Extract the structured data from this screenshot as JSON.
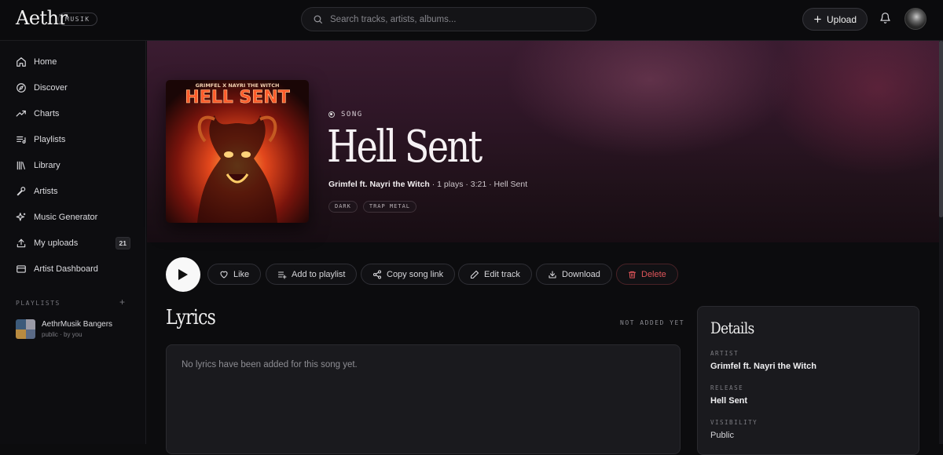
{
  "app": {
    "logo": "Aethr",
    "badge": "MUSIK"
  },
  "search": {
    "placeholder": "Search tracks, artists, albums..."
  },
  "header": {
    "upload_label": "Upload"
  },
  "sidebar": {
    "items": [
      {
        "label": "Home",
        "icon": "home-icon"
      },
      {
        "label": "Discover",
        "icon": "compass-icon"
      },
      {
        "label": "Charts",
        "icon": "trending-icon"
      },
      {
        "label": "Playlists",
        "icon": "list-music-icon"
      },
      {
        "label": "Library",
        "icon": "library-icon"
      },
      {
        "label": "Artists",
        "icon": "mic-icon"
      },
      {
        "label": "Music Generator",
        "icon": "sparkles-icon"
      },
      {
        "label": "My uploads",
        "icon": "upload-icon",
        "count": "21"
      },
      {
        "label": "Artist Dashboard",
        "icon": "dashboard-icon"
      }
    ],
    "playlists_header": "PLAYLISTS",
    "playlists_add": "+",
    "playlists": [
      {
        "name": "AethrMusik Bangers",
        "sub": "public · by you"
      }
    ]
  },
  "song": {
    "label": "SONG",
    "title": "Hell Sent",
    "artist": "Grimfel ft. Nayri the Witch",
    "meta_rest": " · 1 plays · 3:21 · Hell Sent",
    "tags": [
      "DARK",
      "TRAP METAL"
    ],
    "cover_text_top": "GRIMFEL X   NAYRI THE WITCH",
    "cover_text_main": "HELL SENT"
  },
  "actions": {
    "like": "Like",
    "add_to_playlist": "Add to playlist",
    "copy_link": "Copy song link",
    "edit": "Edit track",
    "download": "Download",
    "delete": "Delete"
  },
  "lyrics": {
    "title": "Lyrics",
    "status": "NOT ADDED YET",
    "empty": "No lyrics have been added for this song yet."
  },
  "details": {
    "title": "Details",
    "artist_label": "ARTIST",
    "artist_value": "Grimfel ft. Nayri the Witch",
    "release_label": "RELEASE",
    "release_value": "Hell Sent",
    "visibility_label": "VISIBILITY",
    "visibility_value": "Public"
  },
  "colors": {
    "accent_delete": "#e0555a",
    "hero_bg": "#3b1c31"
  }
}
